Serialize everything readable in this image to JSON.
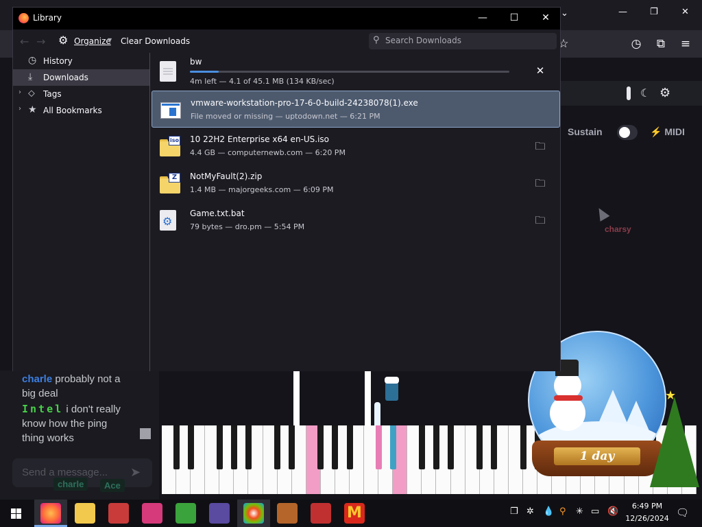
{
  "library": {
    "title": "Library",
    "toolbar": {
      "organize_label": "Organize",
      "clear_downloads_label": "Clear Downloads",
      "search_placeholder": "Search Downloads"
    },
    "sidebar": [
      {
        "label": "History",
        "icon": "clock-icon"
      },
      {
        "label": "Downloads",
        "icon": "download-icon",
        "selected": true
      },
      {
        "label": "Tags",
        "icon": "tag-icon"
      },
      {
        "label": "All Bookmarks",
        "icon": "star-icon"
      }
    ],
    "downloads": [
      {
        "name": "bw",
        "status": "4m left — 4.1 of 45.1 MB (134 KB/sec)",
        "progress": 0.091,
        "icon": "document-icon",
        "action": "cancel"
      },
      {
        "name": "vmware-workstation-pro-17-6-0-build-24238078(1).exe",
        "status": "File moved or missing — uptodown.net — 6:21 PM",
        "icon": "exe-icon",
        "action": "none"
      },
      {
        "name": "10 22H2 Enterprise x64 en-US.iso",
        "status": "4.4 GB — computernewb.com — 6:20 PM",
        "icon": "iso-icon",
        "badge": "iso",
        "action": "show-folder"
      },
      {
        "name": "NotMyFault(2).zip",
        "status": "1.4 MB — majorgeeks.com — 6:09 PM",
        "icon": "zip-icon",
        "badge": "Z",
        "action": "show-folder"
      },
      {
        "name": "Game.txt.bat",
        "status": "79 bytes — dro.pm — 5:54 PM",
        "icon": "batch-file-icon",
        "action": "show-folder"
      }
    ]
  },
  "page": {
    "sustain_label": "Sustain",
    "midi_label": "MIDI",
    "cursor_user": "charsy",
    "chat": [
      {
        "user": "charle",
        "text": "probably not a big deal"
      },
      {
        "user": "Intel",
        "text": "i don't really know how the ping thing works"
      }
    ],
    "chat_placeholder": "Send a message...",
    "chips": [
      "charle",
      "Ace"
    ],
    "globe_label": "1 day"
  },
  "taskbar": {
    "time": "6:49 PM",
    "date": "12/26/2024"
  }
}
